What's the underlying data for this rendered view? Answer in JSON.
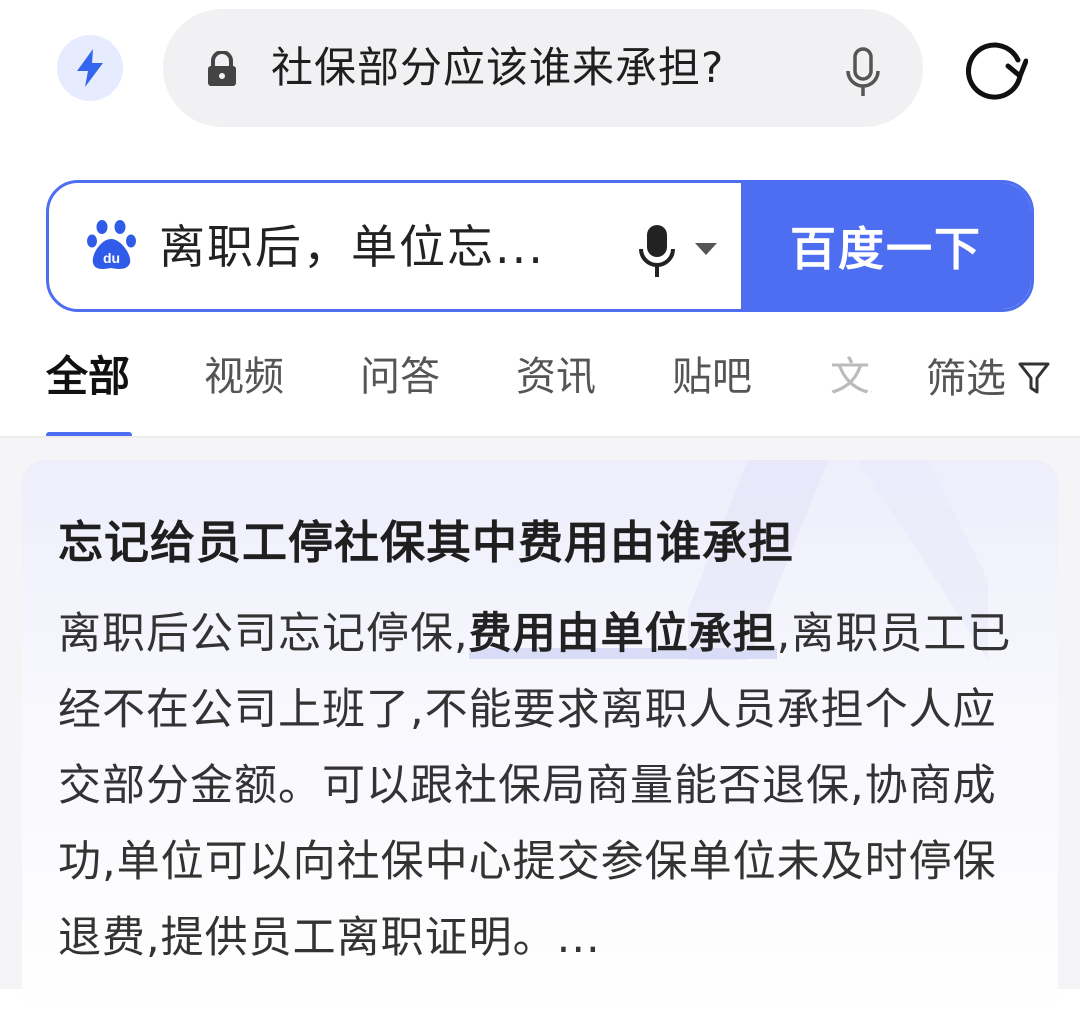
{
  "browser": {
    "url_text": "社保部分应该谁来承担?",
    "bolt_icon": "lightning-bolt-icon",
    "lock_icon": "lock-icon",
    "mic_icon": "microphone-icon",
    "refresh_icon": "refresh-icon"
  },
  "search": {
    "query": "离职后，单位忘...",
    "logo_icon": "baidu-paw-icon",
    "button_label": "百度一下",
    "accent_color": "#4e6ef2"
  },
  "tabs": {
    "items": [
      {
        "label": "全部",
        "active": true
      },
      {
        "label": "视频"
      },
      {
        "label": "问答"
      },
      {
        "label": "资讯"
      },
      {
        "label": "贴吧"
      },
      {
        "label": "文库"
      }
    ],
    "filter_label": "筛选"
  },
  "card": {
    "title": "忘记给员工停社保其中费用由谁承担",
    "body_before": "离职后公司忘记停保,",
    "body_highlight": "费用由单位承担",
    "body_after": ",离职员工已经不在公司上班了,不能要求离职人员承担个人应交部分金额。可以跟社保局商量能否退保,协商成功,单位可以向社保中心提交参保单位未及时停保退费,提供员工离职证明。..."
  }
}
